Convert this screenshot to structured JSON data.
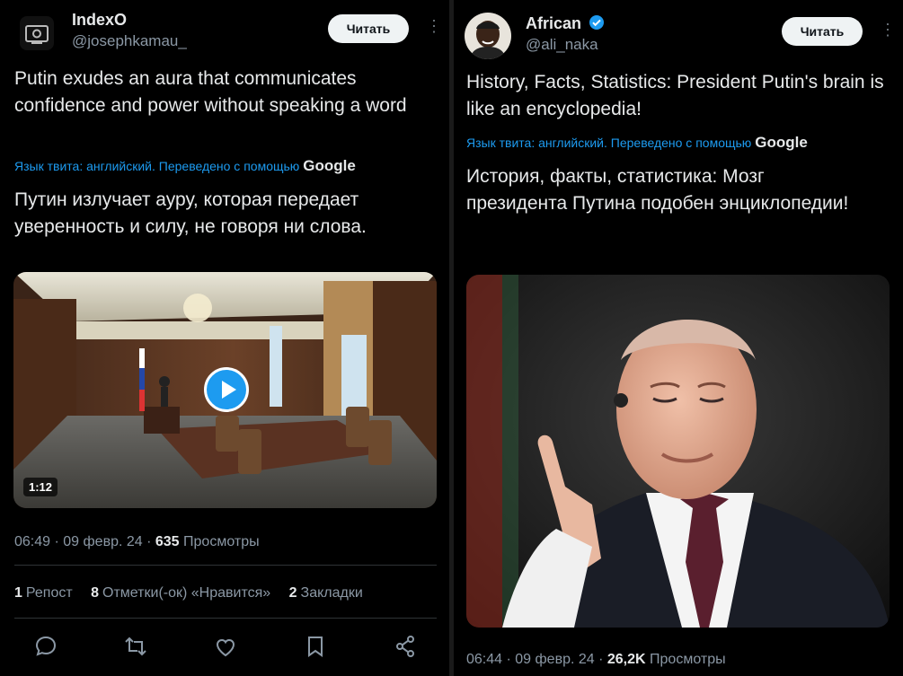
{
  "left": {
    "user_name": "IndexO",
    "handle": "@josephkamau_",
    "follow_label": "Читать",
    "text_en": "Putin exudes an aura that communicates confidence and power without speaking a word",
    "translate_note": "Язык твита: английский. Переведено с помощью",
    "translate_brand": "Google",
    "text_ru": "Путин излучает ауру, которая передает уверенность и силу, не говоря ни слова.",
    "video_duration": "1:12",
    "timestamp": "06:49 · 09 февр. 24 ·",
    "views_count": "635",
    "views_label": "Просмотры",
    "stats": [
      {
        "count": "1",
        "label": "Репост"
      },
      {
        "count": "8",
        "label": "Отметки(-ок) «Нравится»"
      },
      {
        "count": "2",
        "label": "Закладки"
      }
    ],
    "actions": [
      "reply-icon",
      "repost-icon",
      "like-icon",
      "bookmark-icon",
      "share-icon"
    ]
  },
  "right": {
    "user_name": "African",
    "handle": "@ali_naka",
    "follow_label": "Читать",
    "text_en": "History, Facts, Statistics: President Putin's brain is like an encyclopedia!",
    "translate_note": "Язык твита: английский. Переведено с помощью",
    "translate_brand": "Google",
    "text_ru": "История, факты, статистика: Мозг президента Путина подобен энциклопедии!",
    "timestamp": "06:44 · 09 февр. 24 ·",
    "views_count": "26,2K",
    "views_label": "Просмотры"
  },
  "colors": {
    "background": "#000000",
    "link": "#1d9bf0",
    "verified": "#1d9bf0",
    "muted": "#8b98a5"
  }
}
